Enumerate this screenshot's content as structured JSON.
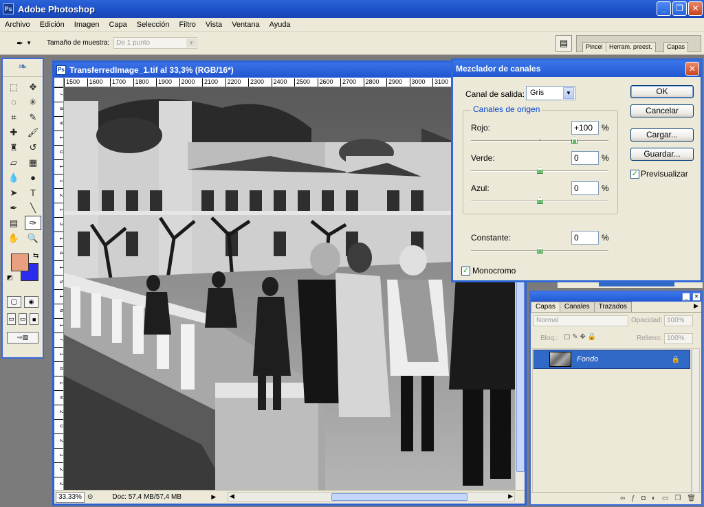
{
  "app": {
    "title": "Adobe Photoshop",
    "window_controls": [
      "_",
      "❐",
      "✕"
    ]
  },
  "menu": [
    "Archivo",
    "Edición",
    "Imagen",
    "Capa",
    "Selección",
    "Filtro",
    "Vista",
    "Ventana",
    "Ayuda"
  ],
  "options_bar": {
    "sample_label": "Tamaño de muestra:",
    "sample_value": "De 1 punto",
    "palette_tabs": [
      "Pincel",
      "Herram. preest.",
      "Capas"
    ]
  },
  "document": {
    "title": "TransferredImage_1.tif al 33,3% (RGB/16*)",
    "ruler_h": [
      "1500",
      "1600",
      "1700",
      "1800",
      "1900",
      "2000",
      "2100",
      "2200",
      "2300",
      "2400",
      "2500",
      "2600",
      "2700",
      "2800",
      "2900",
      "3000",
      "3100"
    ],
    "ruler_v": [
      "7",
      "8",
      "9",
      "1",
      "0",
      "1",
      "1",
      "2",
      "1",
      "3",
      "1",
      "4",
      "1",
      "5",
      "1",
      "6",
      "1",
      "7",
      "1",
      "8",
      "1",
      "9",
      "2",
      "0",
      "2",
      "1",
      "2",
      "2"
    ],
    "zoom": "33,33%",
    "doc_info": "Doc: 57,4 MB/57,4 MB"
  },
  "dialog": {
    "title": "Mezclador de canales",
    "output_label": "Canal de salida:",
    "output_value": "Gris",
    "source_group": "Canales de origen",
    "red_label": "Rojo:",
    "red_value": "+100",
    "green_label": "Verde:",
    "green_value": "0",
    "blue_label": "Azul:",
    "blue_value": "0",
    "constant_label": "Constante:",
    "constant_value": "0",
    "percent": "%",
    "monochrome_label": "Monocromo",
    "monochrome_checked": true,
    "preview_label": "Previsualizar",
    "preview_checked": true,
    "buttons": {
      "ok": "OK",
      "cancel": "Cancelar",
      "load": "Cargar...",
      "save": "Guardar..."
    },
    "slider_levels": {
      "red": 100,
      "green": 0,
      "blue": 0,
      "constant": 0
    }
  },
  "layers_panel": {
    "tabs": [
      "Capas",
      "Canales",
      "Trazados"
    ],
    "blend_mode": "Normal",
    "opacity_label": "Opacidad:",
    "opacity_value": "100%",
    "lock_label": "Bloq.:",
    "fill_label": "Relleno:",
    "fill_value": "100%",
    "layer_name": "Fondo"
  },
  "colors": {
    "foreground": "#e8a080",
    "background": "#2c2cf0",
    "xp_blue": "#2d62d6",
    "selected_layer": "#3169c6"
  }
}
